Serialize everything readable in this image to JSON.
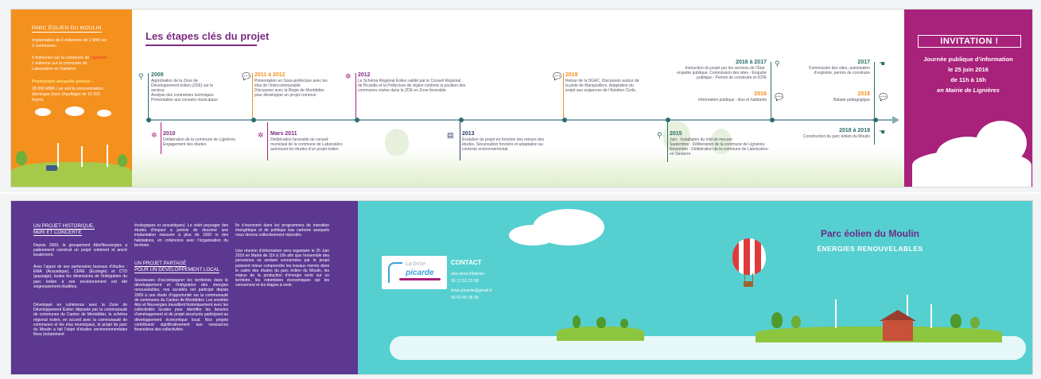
{
  "top": {
    "left_panel": {
      "title": "PARC ÉOLIEN DU MOULIN",
      "lines": [
        "Implantation de 6 éoliennes de 2  MW sur",
        "2 communes :"
      ],
      "commune_lines": [
        {
          "prefix": "5 éoliennes sur la commune de ",
          "highlight": "Lignières"
        },
        {
          "prefix": "1 éolienne sur la commune de",
          "highlight": ""
        },
        {
          "prefix": "Laboissière-en-Santerre",
          "highlight": ""
        }
      ],
      "production_title": "Production annuelle prévue :",
      "production_lines": [
        "28 000  MWh / an soit la consommation",
        "électrique (hors chauffage) de 10 000",
        "foyers."
      ]
    },
    "timeline": {
      "title": "Les étapes clés du projet",
      "events_above": [
        {
          "year": "2009",
          "lines": [
            "Approbation de la  Zone de",
            "Développement éolien (ZDE) sur le",
            "secteur.",
            "Analyse des contraintes techniques",
            "Présentation aux conseils municipaux"
          ]
        },
        {
          "year": "2011 à 2012",
          "lines": [
            "Présentation en Sous-préfecture avec les",
            "élus de l’intercommunalité",
            "Discussion avec la Régie de  Montdidier",
            "pour développer un projet commun"
          ]
        },
        {
          "year": "2012",
          "lines": [
            "Le Schéma  Régional Éolien validé par le Conseil  Régional",
            "de Picardie et la Préfecture de région conforte la position des",
            "communes visées dans la ZDE en Zone favorable."
          ]
        },
        {
          "year": "2019",
          "lines": [
            "Retour de la DGAC. Discussion autour de",
            "la piste de  Marquivillers. Adaptation du",
            "projet aux exigences de l’Aviation Civile."
          ]
        },
        {
          "year": "2016 à 2017",
          "lines": [
            "Instruction du projet par les services de l’État :",
            "enquête publique, Commission des sites - Enquête",
            "publique - Permis de construire et ICPE"
          ]
        },
        {
          "year": "2016",
          "lines": [
            "Information publique : élus et habitants"
          ]
        },
        {
          "year": "2017",
          "lines": [
            "Commission des sites, autorisation",
            "d’exploiter, permis de construire"
          ]
        },
        {
          "year": "2018",
          "lines": [
            "Balade pédagogique"
          ]
        }
      ],
      "events_below": [
        {
          "year": "2010",
          "lines": [
            "Délibération de la commune de Lignières",
            "Engagement des études"
          ]
        },
        {
          "year": "Mars 2011",
          "lines": [
            "Délibération favorable du conseil",
            "municipal de la commune de Laboissière",
            "autorisant les études d’un projet éolien"
          ]
        },
        {
          "year": "2013",
          "lines": [
            "Évolution du projet en fonction des retours des",
            "études. Sécurisation foncière et adaptation au",
            "contexte environnemental."
          ]
        },
        {
          "year": "2015",
          "lines": [
            "Juin : Installation du mât de mesure",
            "Septembre : Délibération de la commune de  Lignières",
            "Novembre : Délibération de la commune de  Laboissière-",
            "en-Santerre"
          ]
        },
        {
          "year": "2018 à 2019",
          "lines": [
            "Construction du parc éolien du  Moulin"
          ]
        }
      ]
    },
    "invitation": {
      "title": "INVITATION !",
      "line1": "Journée publique d’information",
      "line2": "le 25 juin 2016",
      "line3": "de 11h à 16h",
      "line4": "en Mairie de Lignières"
    }
  },
  "bottom": {
    "col1": {
      "heading1": "UN PROJET HISTORIQUE,",
      "heading2": "MûRI ET CONCERTÉ",
      "p1": "Depuis 2009, le groupement Abo/Nouvergies a patiemment construit un projet cohérent et ancré localement.",
      "p2": "Avec l’appui de ses partenaires bureaux d’études : EMA (Acoustique), CERE (Écologie) et CTD (paysage), toutes les dimensions de l’intégration du parc éolien à son environnement ont été soigneusement étudiées.",
      "p3": "Développé en cohérence avec la Zone de Développement Éolien déposée par la communauté de communes du Canton de Montdidier, le schéma régional éolien, en accord avec la communauté de communes et les élus municipaux, le projet du parc du Moulin a fait l’objet d’études environnementales fines (notamment"
    },
    "col2": {
      "p1": "écologiques et acoustiques). Le volet paysager des études d’impact a permis de dessiner une implantation mesurée à plus de 1000 m des habitations, en cohérence avec l’organisation du territoire.",
      "heading1": "UN PROJET PARTAGÉ",
      "heading2": "POUR UN DÉVELOPPEMENT LOCAL",
      "p2": "Soucieuses d’accompagner les territoires dans le développement et l’intégration des énergies renouvelables, nos sociétés ont participé depuis 2009 à une étude d’opportunité sur la communauté de communes du Canton de Montdidier. Les sociétés Abo et Nouvergies travaillent historiquement avec les collectivités locales pour identifier les besoins d’aménagement et de projet structurés participant au développement économique local. Nos projets contribuent significativement aux ressources financières des collectivités."
    },
    "col3": {
      "p1": "Ils s’inscrivent dans les programmes de transition énergétique et de politique bas carbone auxquels nous devons collectivement répondre.",
      "p2": "Une réunion d’information sera organisée le 25 Juin 2016 en Mairie de 11h à 16h afin que l’ensemble des personnes se sentant concernées par le projet puissent mieux comprendre les travaux menés dans le cadre des études du parc éolien du Moulin, les enjeux de la production d’énergie verte sur un territoire, les retombées économiques qui les concernent et les étapes à venir."
    },
    "logo": {
      "top": "La brise",
      "main": "picarde"
    },
    "contact": {
      "title": "CONTACT",
      "lines": [
        "abo-wind.fr/labrise",
        "06 12 52 22 58",
        "brise.picarde@gmail.fr",
        "06 62 45 28 95"
      ]
    },
    "park": {
      "title": "Parc éolien du Moulin",
      "subtitle": "ÉNERGIES RENOUVELABLES"
    }
  },
  "colors": {
    "orange": "#f4901e",
    "magenta": "#a8217a",
    "purple": "#5c3891",
    "teal": "#56cfd0",
    "title_purple": "#7b2c81"
  }
}
